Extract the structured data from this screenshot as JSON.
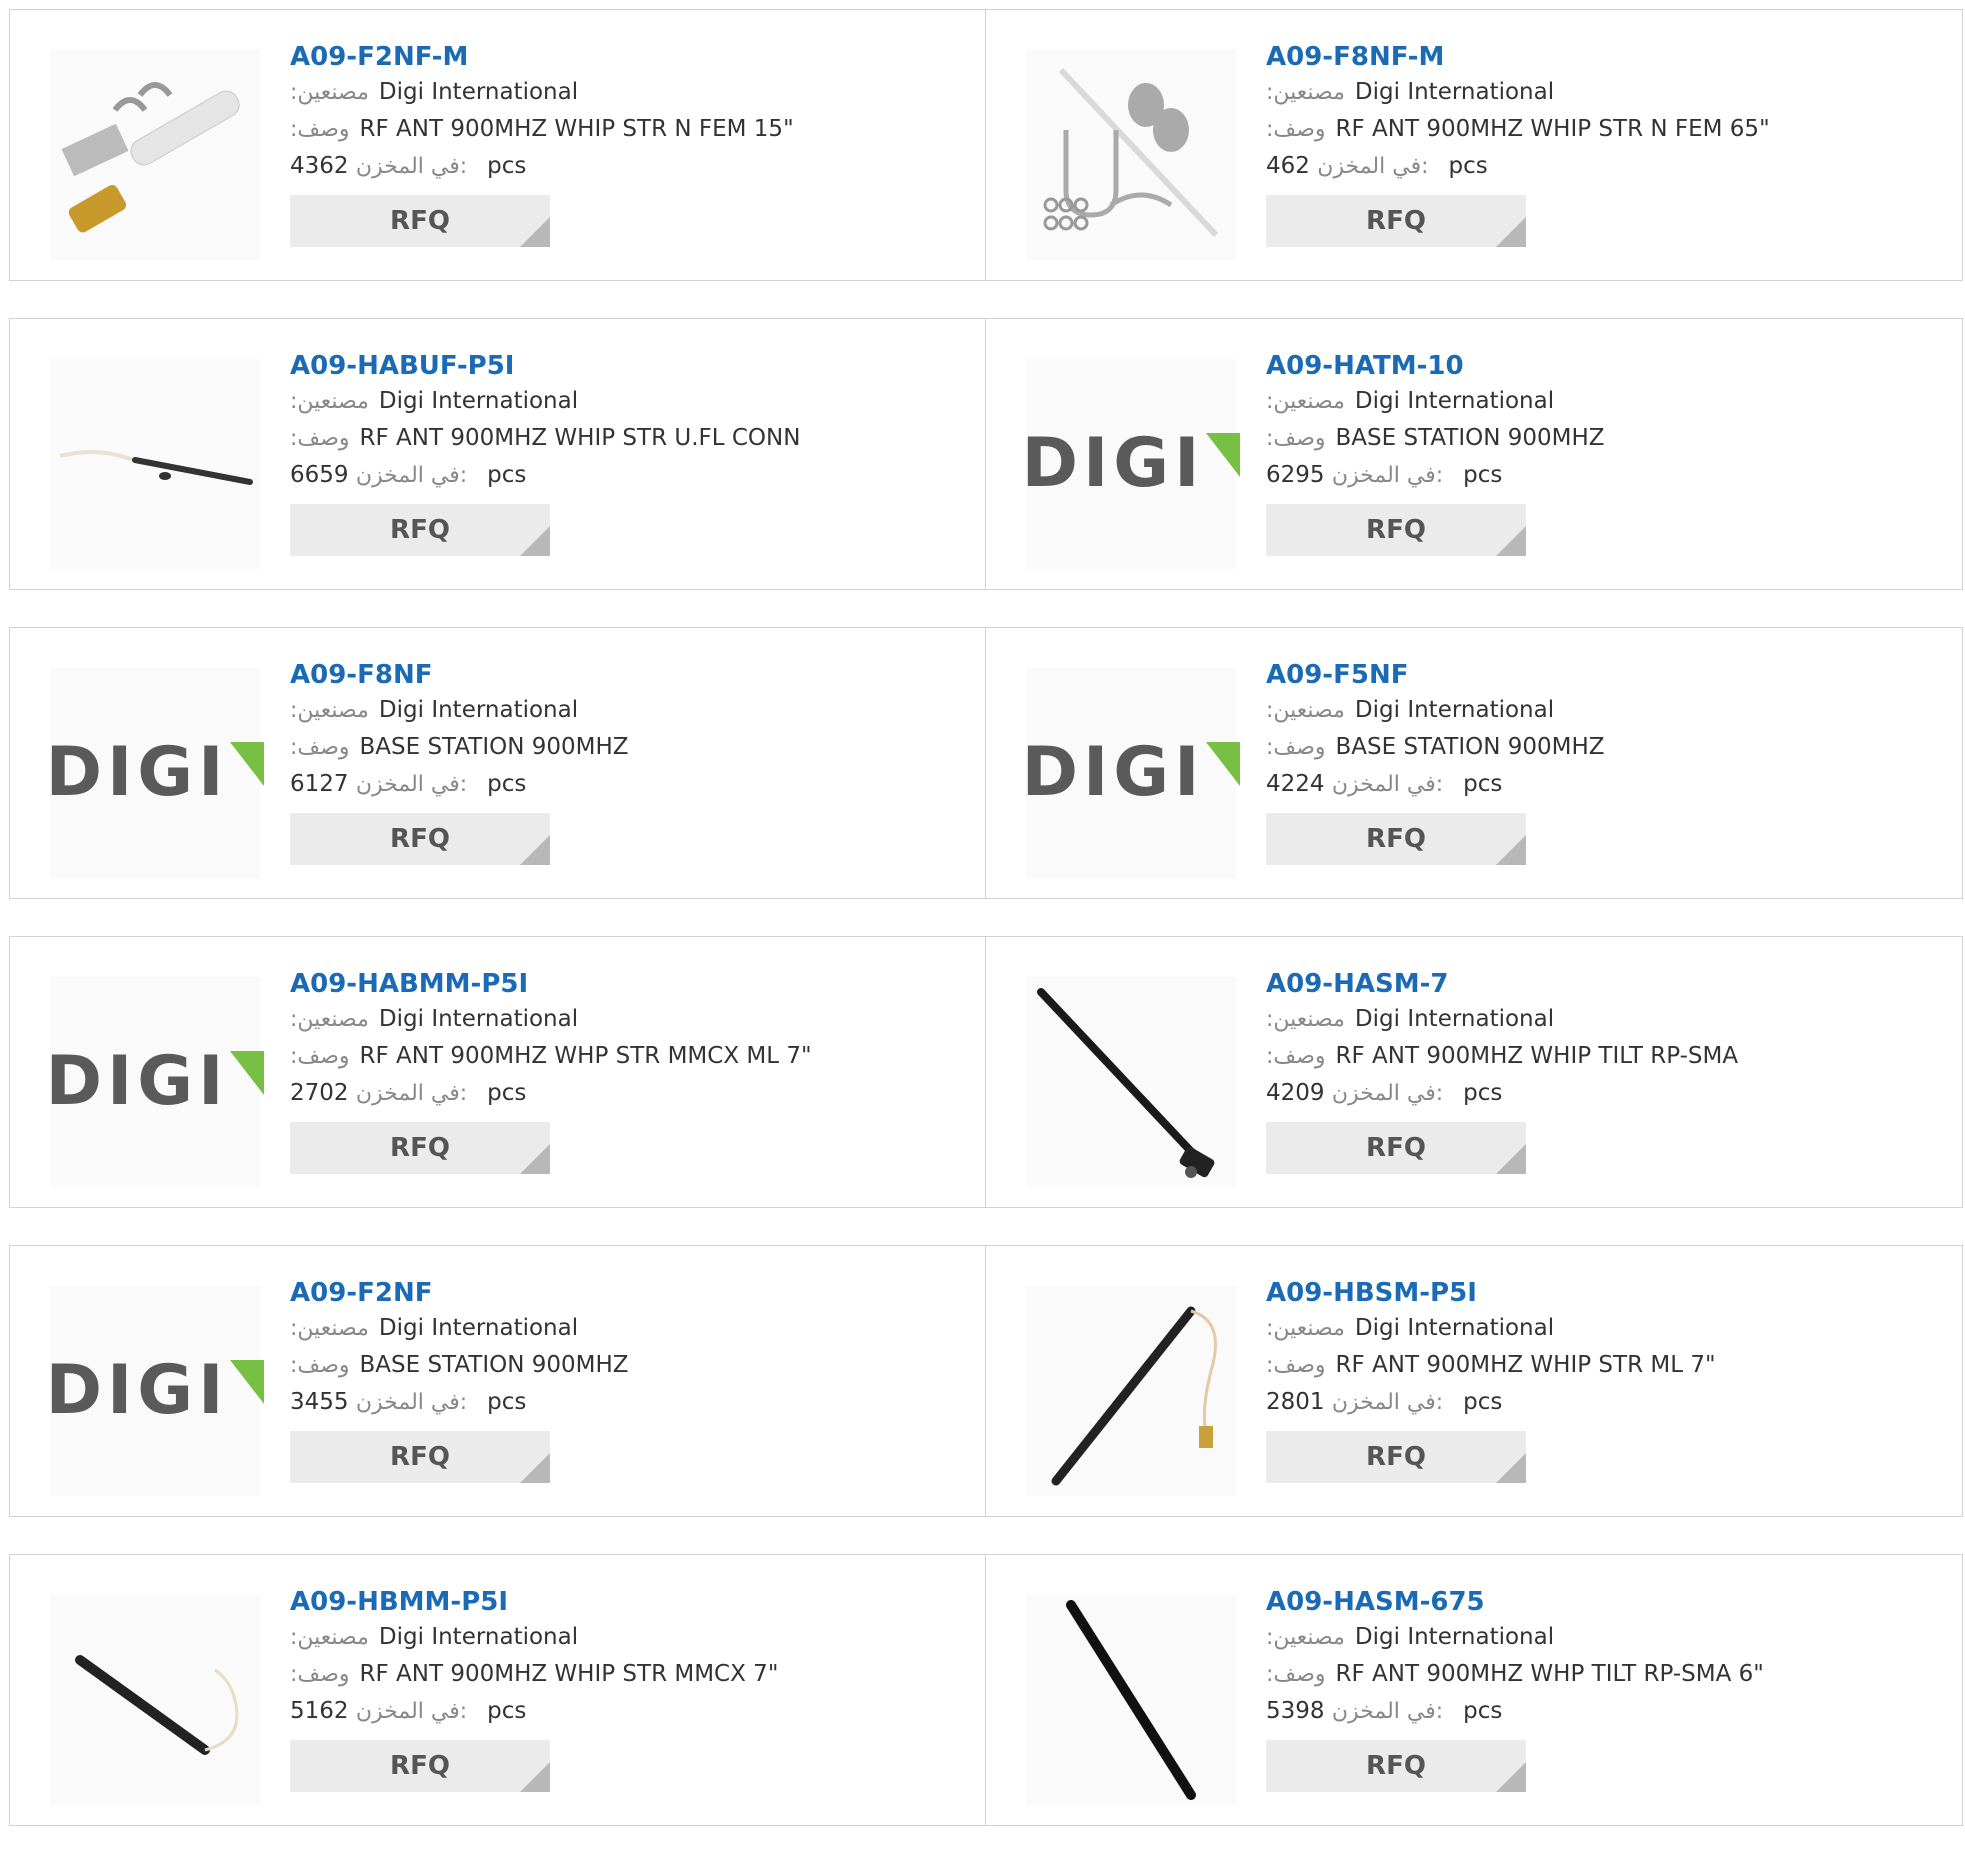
{
  "labels": {
    "manufacturer": ":مصنعين",
    "description": ":وصف",
    "stock": "في المخزن:",
    "unit": "pcs",
    "rfq": "RFQ",
    "logo": "DIGI"
  },
  "colors": {
    "link": "#1a6ab5",
    "rfq_bg": "#ebebeb",
    "logo_green": "#78c043",
    "logo_gray": "#5a5a5a"
  },
  "products": [
    {
      "part": "A09-F2NF-M",
      "mfr": "Digi International",
      "desc": "RF ANT 900MHZ WHIP STR N FEM 15\"",
      "stock": "4362",
      "image": "omni-antenna-mount-kit-image"
    },
    {
      "part": "A09-F8NF-M",
      "mfr": "Digi International",
      "desc": "RF ANT 900MHZ WHIP STR N FEM 65\"",
      "stock": "462",
      "image": "whip-antenna-mount-kit-image"
    },
    {
      "part": "A09-HABUF-P5I",
      "mfr": "Digi International",
      "desc": "RF ANT 900MHZ WHIP STR U.FL CONN",
      "stock": "6659",
      "image": "whip-antenna-ufl-image"
    },
    {
      "part": "A09-HATM-10",
      "mfr": "Digi International",
      "desc": "BASE STATION 900MHZ",
      "stock": "6295",
      "image": "digi-logo"
    },
    {
      "part": "A09-F8NF",
      "mfr": "Digi International",
      "desc": "BASE STATION 900MHZ",
      "stock": "6127",
      "image": "digi-logo"
    },
    {
      "part": "A09-F5NF",
      "mfr": "Digi International",
      "desc": "BASE STATION 900MHZ",
      "stock": "4224",
      "image": "digi-logo"
    },
    {
      "part": "A09-HABMM-P5I",
      "mfr": "Digi International",
      "desc": "RF ANT 900MHZ WHP STR MMCX ML 7\"",
      "stock": "2702",
      "image": "digi-logo"
    },
    {
      "part": "A09-HASM-7",
      "mfr": "Digi International",
      "desc": "RF ANT 900MHZ WHIP TILT RP-SMA",
      "stock": "4209",
      "image": "tilt-antenna-image"
    },
    {
      "part": "A09-F2NF",
      "mfr": "Digi International",
      "desc": "BASE STATION 900MHZ",
      "stock": "3455",
      "image": "digi-logo"
    },
    {
      "part": "A09-HBSM-P5I",
      "mfr": "Digi International",
      "desc": "RF ANT 900MHZ WHIP STR ML 7\"",
      "stock": "2801",
      "image": "antenna-with-cable-image"
    },
    {
      "part": "A09-HBMM-P5I",
      "mfr": "Digi International",
      "desc": "RF ANT 900MHZ WHIP STR MMCX 7\"",
      "stock": "5162",
      "image": "antenna-with-cable-image"
    },
    {
      "part": "A09-HASM-675",
      "mfr": "Digi International",
      "desc": "RF ANT 900MHZ WHP TILT RP-SMA 6\"",
      "stock": "5398",
      "image": "straight-antenna-image"
    }
  ]
}
